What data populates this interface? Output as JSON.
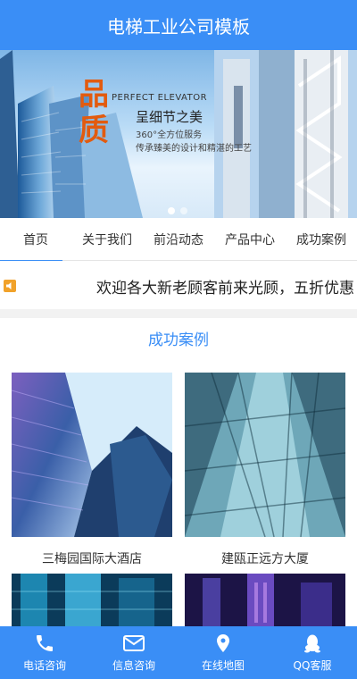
{
  "header": {
    "title": "电梯工业公司模板"
  },
  "banner": {
    "big_text": "品质",
    "english": "PERFECT ELEVATOR",
    "headline": "呈细节之美",
    "sub1": "360°全方位服务",
    "sub2": "传承臻美的设计和精湛的工艺",
    "slide_count": 2,
    "active_slide": 1
  },
  "nav": {
    "items": [
      {
        "label": "首页"
      },
      {
        "label": "关于我们"
      },
      {
        "label": "前沿动态"
      },
      {
        "label": "产品中心"
      },
      {
        "label": "成功案例"
      }
    ]
  },
  "notice": {
    "text": "欢迎各大新老顾客前来光顾，五折优惠"
  },
  "section": {
    "title": "成功案例"
  },
  "cases": [
    {
      "caption": "三梅园国际大酒店"
    },
    {
      "caption": "建瓯正远方大厦"
    },
    {
      "caption": ""
    },
    {
      "caption": ""
    }
  ],
  "footer": {
    "items": [
      {
        "label": "电话咨询",
        "icon": "phone-icon"
      },
      {
        "label": "信息咨询",
        "icon": "mail-icon"
      },
      {
        "label": "在线地图",
        "icon": "map-pin-icon"
      },
      {
        "label": "QQ客服",
        "icon": "qq-icon"
      }
    ]
  },
  "colors": {
    "brand": "#3a8ef6",
    "accent": "#e25b0f"
  }
}
